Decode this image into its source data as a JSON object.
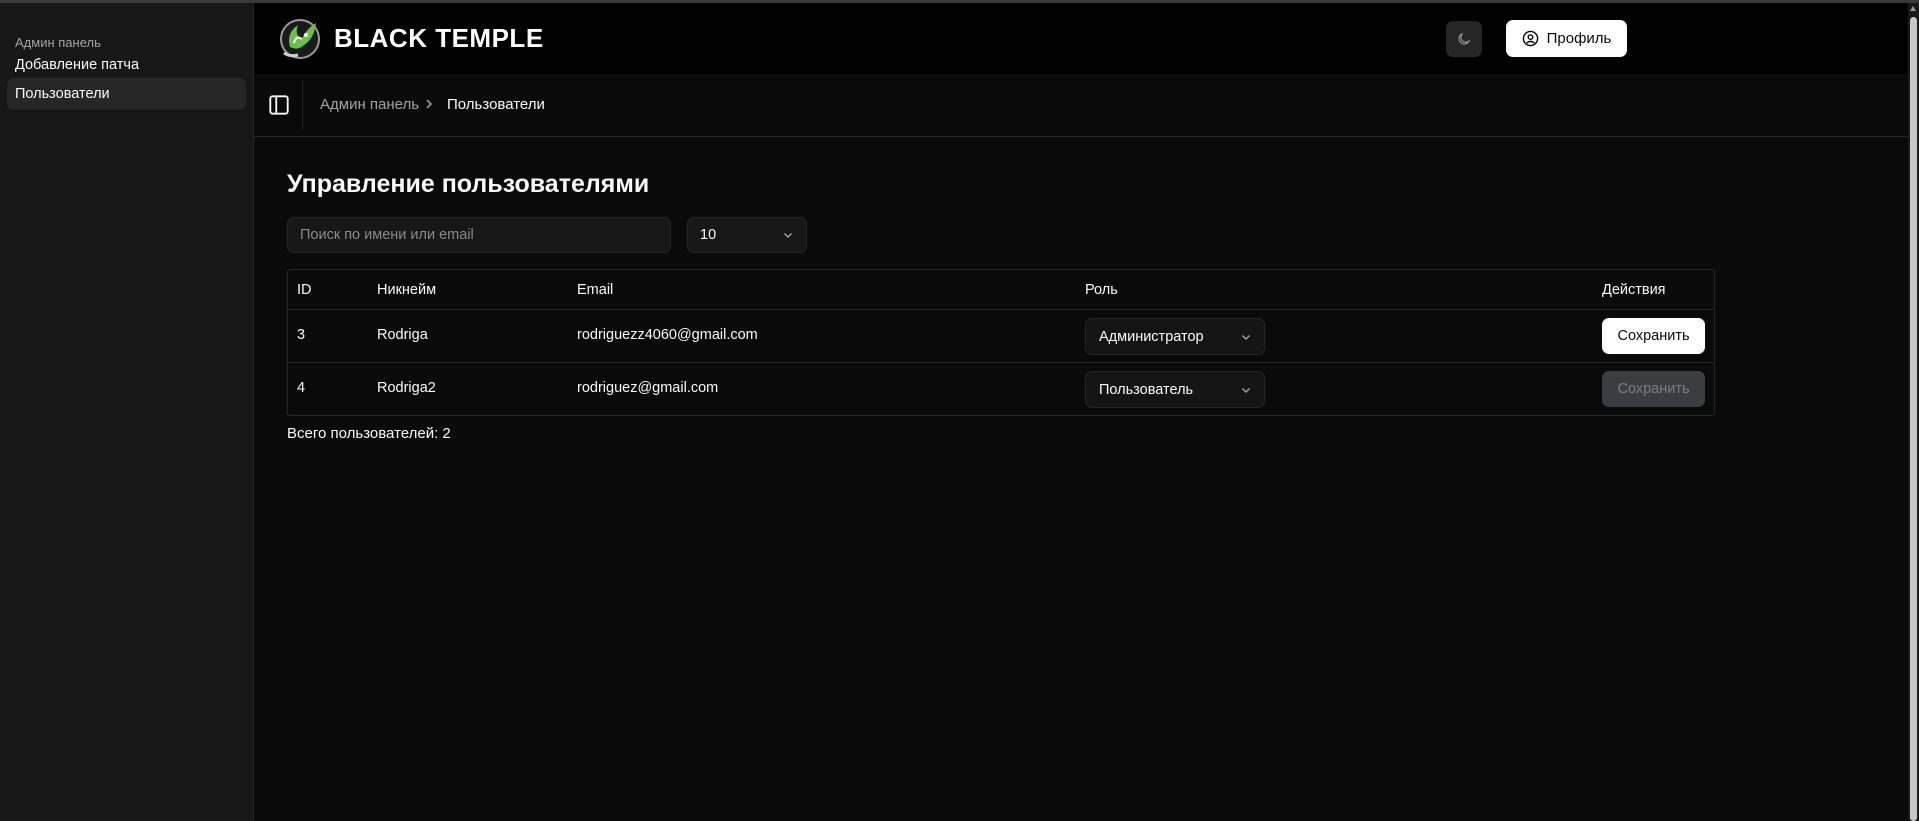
{
  "sidebar": {
    "group_label": "Админ панель",
    "items": [
      {
        "label": "Добавление патча"
      },
      {
        "label": "Пользователи"
      }
    ]
  },
  "header": {
    "brand": "BLACK TEMPLE",
    "theme_icon": "moon-icon",
    "profile_label": "Профиль",
    "profile_icon": "user-circle-icon"
  },
  "breadcrumb": {
    "parent": "Админ панель",
    "current": "Пользователи"
  },
  "main": {
    "title": "Управление пользователями",
    "search_placeholder": "Поиск по имени или email",
    "search_value": "",
    "page_size": "10",
    "columns": {
      "id": "ID",
      "nickname": "Никнейм",
      "email": "Email",
      "role": "Роль",
      "actions": "Действия"
    },
    "rows": [
      {
        "id": "3",
        "nickname": "Rodriga",
        "email": "rodriguezz4060@gmail.com",
        "role": "Администратор",
        "action": "Сохранить",
        "action_enabled": true
      },
      {
        "id": "4",
        "nickname": "Rodriga2",
        "email": "rodriguez@gmail.com",
        "role": "Пользователь",
        "action": "Сохранить",
        "action_enabled": false
      }
    ],
    "total": "Всего пользователей: 2"
  },
  "colors": {
    "background": "#0a0a0a",
    "sidebar": "#171717",
    "header": "#000000",
    "accent_green": "#6cc04a",
    "button_primary": "#ffffff",
    "button_disabled": "#3a3d42"
  }
}
